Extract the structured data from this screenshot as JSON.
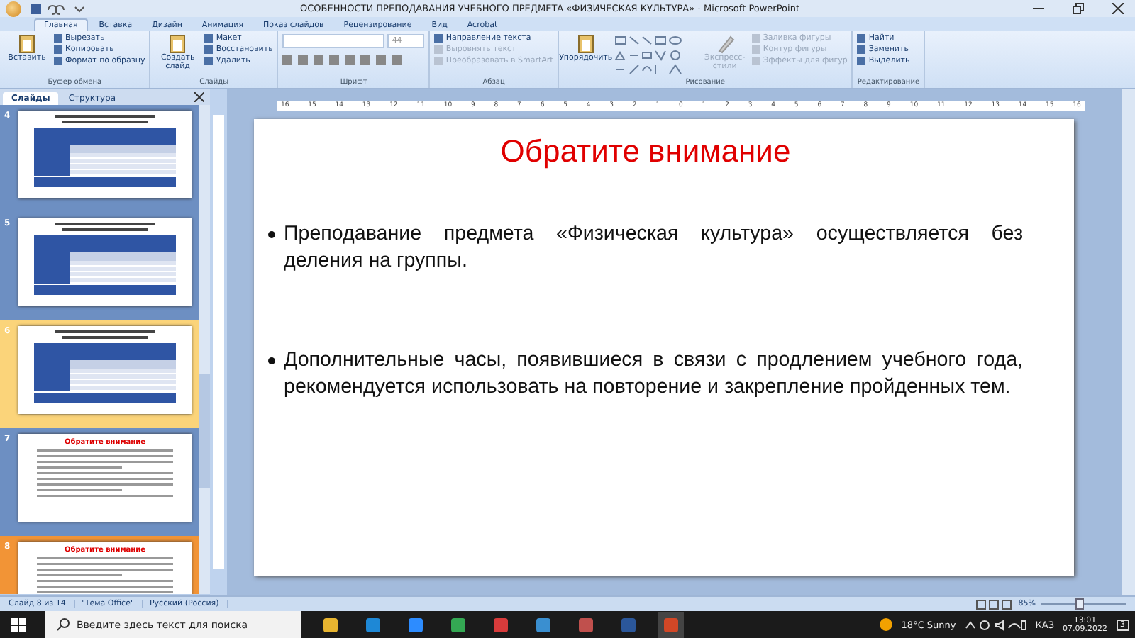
{
  "window": {
    "title": "ОСОБЕННОСТИ ПРЕПОДАВАНИЯ УЧЕБНОГО ПРЕДМЕТА «ФИЗИЧЕСКАЯ КУЛЬТУРА» - Microsoft PowerPoint"
  },
  "ribbon_tabs": [
    {
      "label": "Главная",
      "selected": true
    },
    {
      "label": "Вставка",
      "selected": false
    },
    {
      "label": "Дизайн",
      "selected": false
    },
    {
      "label": "Анимация",
      "selected": false
    },
    {
      "label": "Показ слайдов",
      "selected": false
    },
    {
      "label": "Рецензирование",
      "selected": false
    },
    {
      "label": "Вид",
      "selected": false
    },
    {
      "label": "Acrobat",
      "selected": false
    }
  ],
  "ribbon_groups": [
    {
      "label": "Буфер обмена",
      "big": "Вставить",
      "small": [
        {
          "label": "Вырезать",
          "disabled": false
        },
        {
          "label": "Копировать",
          "disabled": false
        },
        {
          "label": "Формат по образцу",
          "disabled": false
        }
      ]
    },
    {
      "label": "Слайды",
      "big": "Создать слайд",
      "small": [
        {
          "label": "Макет",
          "disabled": false
        },
        {
          "label": "Восстановить",
          "disabled": false
        },
        {
          "label": "Удалить",
          "disabled": false
        }
      ]
    },
    {
      "label": "Шрифт",
      "font_size": "44"
    },
    {
      "label": "Абзац",
      "small": [
        {
          "label": "Направление текста",
          "disabled": false
        },
        {
          "label": "Выровнять текст",
          "disabled": true
        },
        {
          "label": "Преобразовать в SmartArt",
          "disabled": true
        }
      ]
    },
    {
      "label": "Рисование",
      "big": "Упорядочить",
      "big2": "Экспресс-стили",
      "small": [
        {
          "label": "Заливка фигуры",
          "disabled": true
        },
        {
          "label": "Контур фигуры",
          "disabled": true
        },
        {
          "label": "Эффекты для фигур",
          "disabled": true
        }
      ]
    },
    {
      "label": "Редактирование",
      "small": [
        {
          "label": "Найти",
          "disabled": false
        },
        {
          "label": "Заменить",
          "disabled": false
        },
        {
          "label": "Выделить",
          "disabled": false
        }
      ]
    }
  ],
  "pane_tabs": [
    {
      "label": "Слайды",
      "selected": true
    },
    {
      "label": "Структура",
      "selected": false
    }
  ],
  "thumbnails": [
    {
      "number": "4",
      "kind": "table",
      "selected": false,
      "hovered": false
    },
    {
      "number": "5",
      "kind": "table",
      "selected": false,
      "hovered": false
    },
    {
      "number": "6",
      "kind": "table",
      "selected": false,
      "hovered": true
    },
    {
      "number": "7",
      "kind": "text",
      "title": "Обратите внимание",
      "selected": false,
      "hovered": false
    },
    {
      "number": "8",
      "kind": "text",
      "title": "Обратите внимание",
      "selected": true,
      "hovered": false
    }
  ],
  "ruler": [
    "16",
    "15",
    "14",
    "13",
    "12",
    "11",
    "10",
    "9",
    "8",
    "7",
    "6",
    "5",
    "4",
    "3",
    "2",
    "1",
    "0",
    "1",
    "2",
    "3",
    "4",
    "5",
    "6",
    "7",
    "8",
    "9",
    "10",
    "11",
    "12",
    "13",
    "14",
    "15",
    "16"
  ],
  "slide": {
    "title": "Обратите внимание",
    "bullets": [
      "Преподавание предмета «Физическая культура» осуществляется без деления на группы.",
      "Дополнительные часы, появившиеся в связи с продлением учебного года, рекомендуется использовать на повторение и закрепление пройденных тем."
    ]
  },
  "status_bar": [
    "Слайд 8 из 14",
    "\"Тема Office\"",
    "Русский (Россия)"
  ],
  "zoom": {
    "reading": "85%",
    "level": 0.45
  },
  "taskbar": {
    "search_placeholder": "Введите здесь текст для поиска",
    "weather": "18°C Sunny",
    "language": "КАЗ",
    "time": "13:01",
    "date": "07.09.2022",
    "notifications": "3"
  }
}
